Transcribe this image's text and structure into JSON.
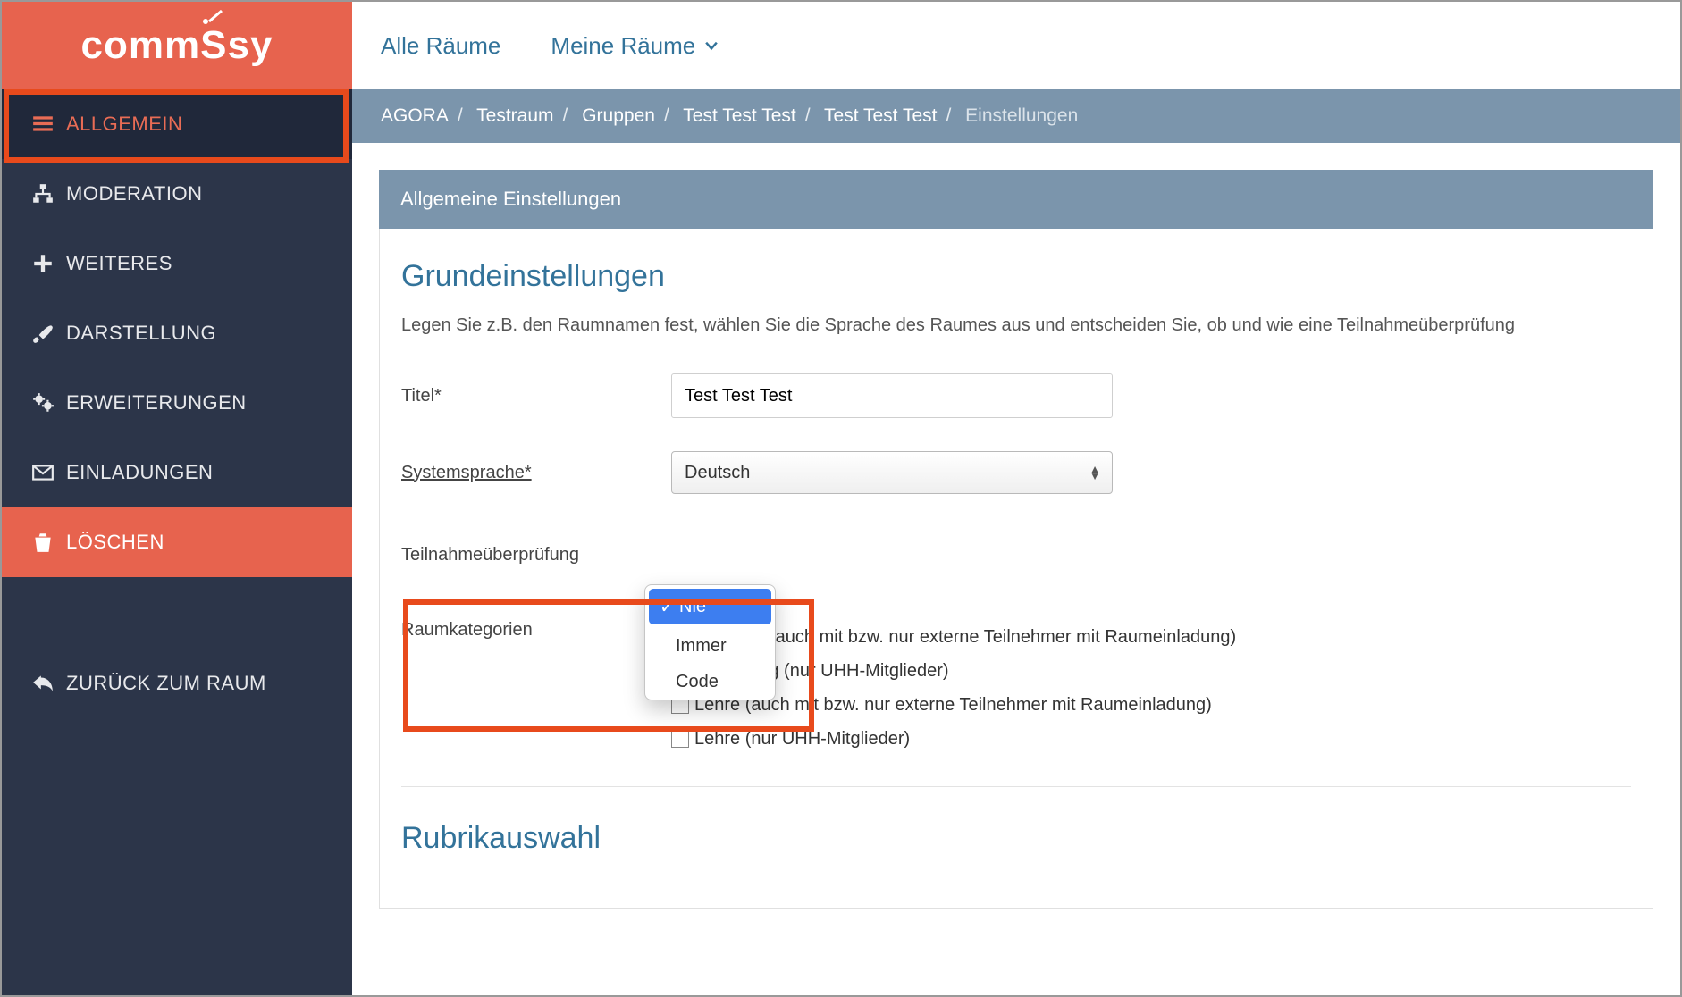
{
  "brand": {
    "name": "commSsy"
  },
  "sidebar": {
    "items": [
      {
        "label": "ALLGEMEIN",
        "icon": "list"
      },
      {
        "label": "MODERATION",
        "icon": "sitemap"
      },
      {
        "label": "WEITERES",
        "icon": "plus"
      },
      {
        "label": "DARSTELLUNG",
        "icon": "brush"
      },
      {
        "label": "ERWEITERUNGEN",
        "icon": "cogs"
      },
      {
        "label": "EINLADUNGEN",
        "icon": "mail"
      },
      {
        "label": "LÖSCHEN",
        "icon": "trash"
      }
    ],
    "back": "ZURÜCK ZUM RAUM"
  },
  "topnav": {
    "all_rooms": "Alle Räume",
    "my_rooms": "Meine Räume"
  },
  "breadcrumb": [
    "AGORA",
    "Testraum",
    "Gruppen",
    "Test Test Test",
    "Test Test Test",
    "Einstellungen"
  ],
  "panel": {
    "title": "Allgemeine Einstellungen",
    "section_basic": "Grundeinstellungen",
    "desc": "Legen Sie z.B. den Raumnamen fest, wählen Sie die Sprache des Raumes aus und entscheiden Sie, ob und wie eine Teilnahmeüberprüfung",
    "form": {
      "title_label": "Titel*",
      "title_value": "Test Test Test",
      "lang_label": "Systemsprache*",
      "lang_value": "Deutsch",
      "part_label": "Teilnahmeüberprüfung",
      "part_options": [
        "Nie",
        "Immer",
        "Code"
      ],
      "part_selected": "Nie",
      "cat_label": "Raumkategorien",
      "cat_options": [
        "(auch mit bzw. nur externe Teilnehmer mit Raumeinladung)",
        "Forschung (nur UHH-Mitglieder)",
        "Lehre (auch mit bzw. nur externe Teilnehmer mit Raumeinladung)",
        "Lehre (nur UHH-Mitglieder)"
      ]
    },
    "section_rubrik": "Rubrikauswahl"
  }
}
